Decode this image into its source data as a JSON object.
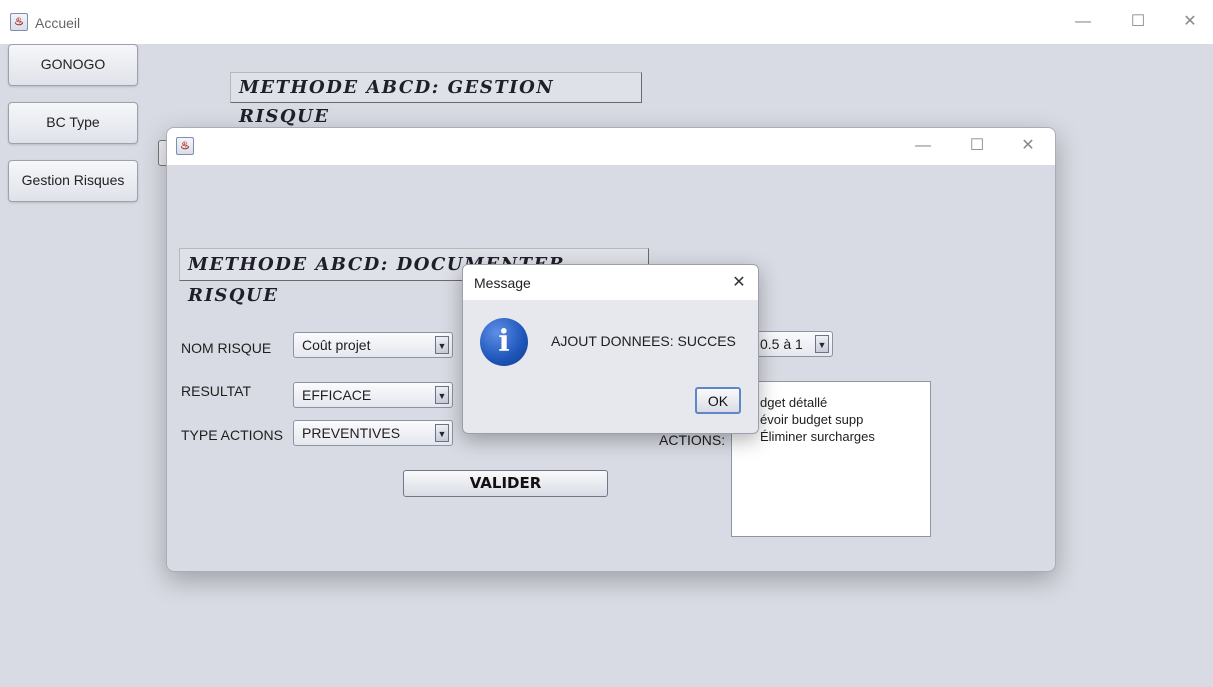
{
  "main_window": {
    "title": "Accueil",
    "controls": {
      "minimize": "—",
      "maximize": "☐",
      "close": "✕"
    }
  },
  "sidebar": {
    "buttons": [
      {
        "label": "GONOGO"
      },
      {
        "label": "BC Type"
      },
      {
        "label": "Gestion Risques"
      }
    ]
  },
  "main_header": "METHODE ABCD: GESTION RISQUE",
  "inner_window": {
    "title": "",
    "controls": {
      "minimize": "—",
      "maximize": "☐",
      "close": "✕"
    },
    "header": "METHODE ABCD: DOCUMENTER RISQUE",
    "form": {
      "nom_risque_label": "NOM RISQUE",
      "nom_risque_value": "Coût projet",
      "resultat_label": "RESULTAT",
      "resultat_value": "EFFICACE",
      "type_actions_label": "TYPE ACTIONS",
      "type_actions_value": "PREVENTIVES",
      "probability_value": "0.5 à 1",
      "actions_label": "ACTIONS:",
      "actions_lines": [
        "dget détallé",
        "évoir budget supp",
        "Éliminer surcharges"
      ],
      "validate_label": "VALIDER"
    }
  },
  "dialog": {
    "title": "Message",
    "close": "✕",
    "icon": "info-icon",
    "icon_glyph": "i",
    "message": "AJOUT DONNEES: SUCCES",
    "ok_label": "OK"
  },
  "colors": {
    "background": "#d9dbe4",
    "info_icon": "#1e55b8"
  }
}
